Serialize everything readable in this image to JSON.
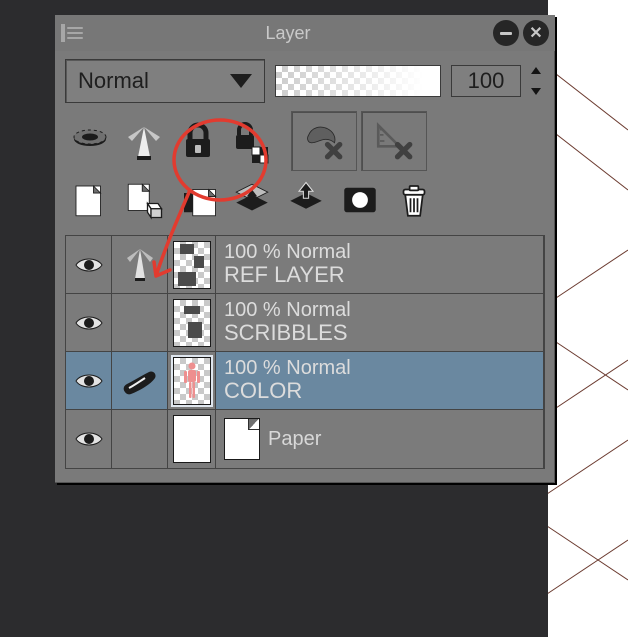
{
  "panel": {
    "title": "Layer",
    "blend_mode": "Normal",
    "opacity": "100"
  },
  "layers": [
    {
      "meta": "100 % Normal",
      "name": "REF LAYER"
    },
    {
      "meta": "100 % Normal",
      "name": "SCRIBBLES"
    },
    {
      "meta": "100 % Normal",
      "name": "COLOR"
    },
    {
      "name": "Paper"
    }
  ]
}
